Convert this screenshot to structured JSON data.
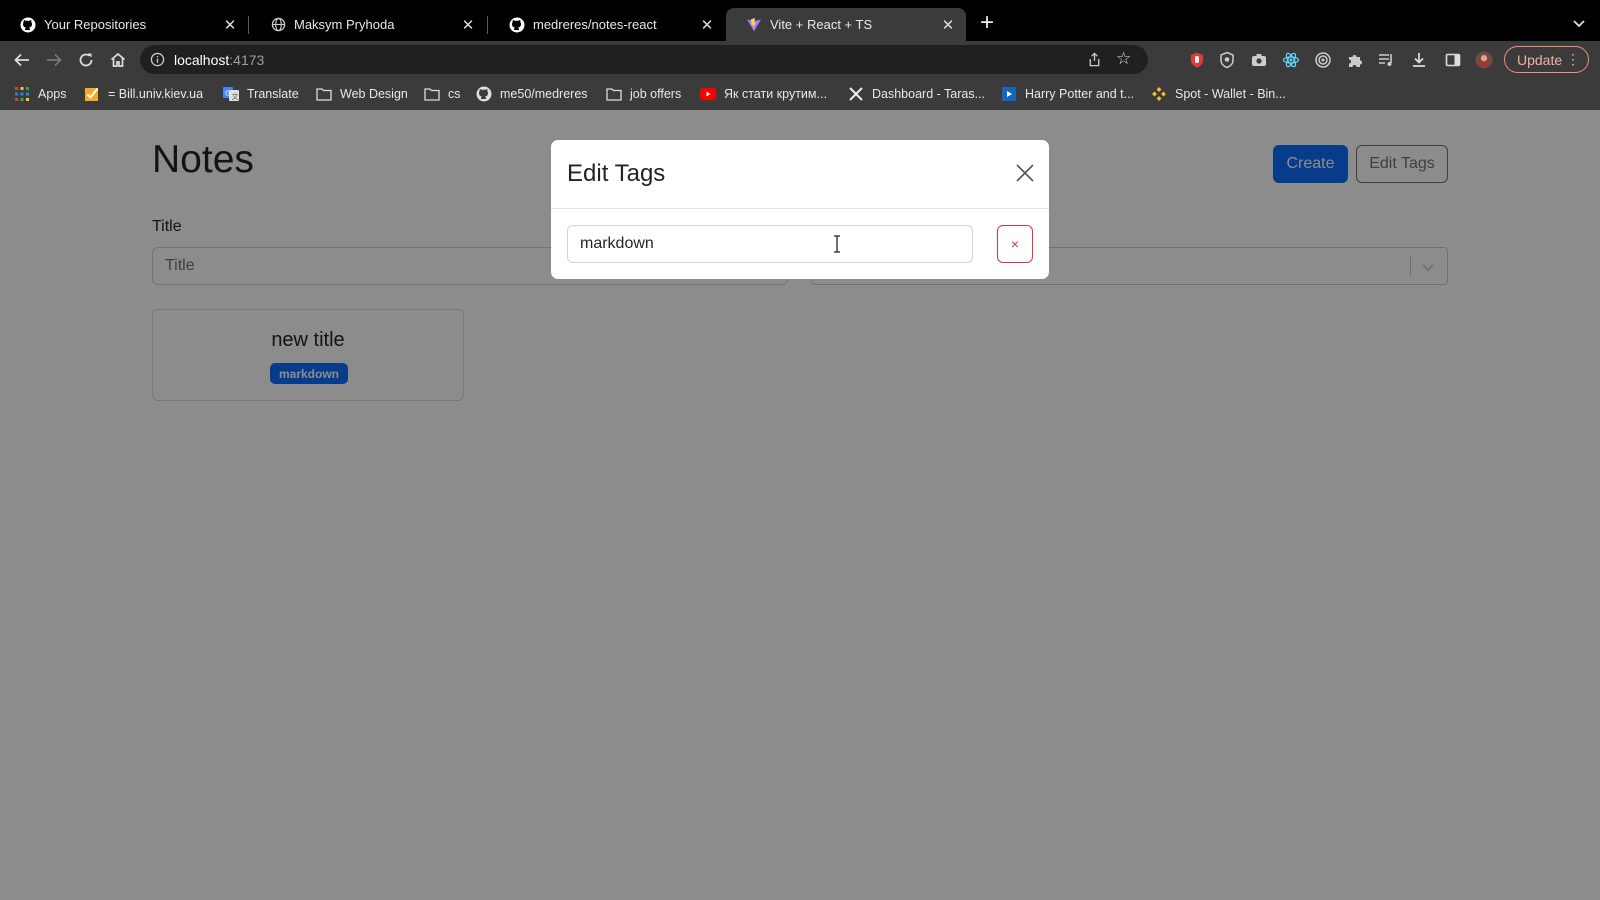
{
  "browser": {
    "tabs": [
      {
        "title": "Your Repositories",
        "icon": "github-icon"
      },
      {
        "title": "Maksym Pryhoda",
        "icon": "globe-icon"
      },
      {
        "title": "medreres/notes-react",
        "icon": "github-icon"
      },
      {
        "title": "Vite + React + TS",
        "icon": "vite-icon",
        "active": true
      }
    ],
    "address": {
      "host": "localhost",
      "port": ":4173"
    },
    "update_label": "Update",
    "bookmarks": [
      {
        "label": "Apps",
        "icon": "apps-grid-icon"
      },
      {
        "label": "= Bill.univ.kiev.ua",
        "icon": "checkbox-icon"
      },
      {
        "label": "Translate",
        "icon": "translate-icon"
      },
      {
        "label": "Web Design",
        "icon": "folder-icon"
      },
      {
        "label": "cs",
        "icon": "folder-icon"
      },
      {
        "label": "me50/medreres",
        "icon": "github-icon"
      },
      {
        "label": "job offers",
        "icon": "folder-icon"
      },
      {
        "label": "Як стати крутим...",
        "icon": "youtube-icon"
      },
      {
        "label": "Dashboard - Taras...",
        "icon": "x-icon"
      },
      {
        "label": "Harry Potter and t...",
        "icon": "video-icon"
      },
      {
        "label": "Spot - Wallet - Bin...",
        "icon": "binance-icon"
      }
    ]
  },
  "page": {
    "title": "Notes",
    "create_label": "Create",
    "edit_tags_label": "Edit Tags",
    "title_field_label": "Title",
    "title_placeholder": "Title",
    "notes": [
      {
        "title": "new title",
        "tags": [
          "markdown"
        ]
      }
    ]
  },
  "modal": {
    "title": "Edit Tags",
    "tags": [
      {
        "value": "markdown",
        "delete_label": "×"
      }
    ]
  },
  "colors": {
    "primary": "#0d6efd",
    "danger": "#dc3545",
    "secondary": "#6c757d"
  }
}
